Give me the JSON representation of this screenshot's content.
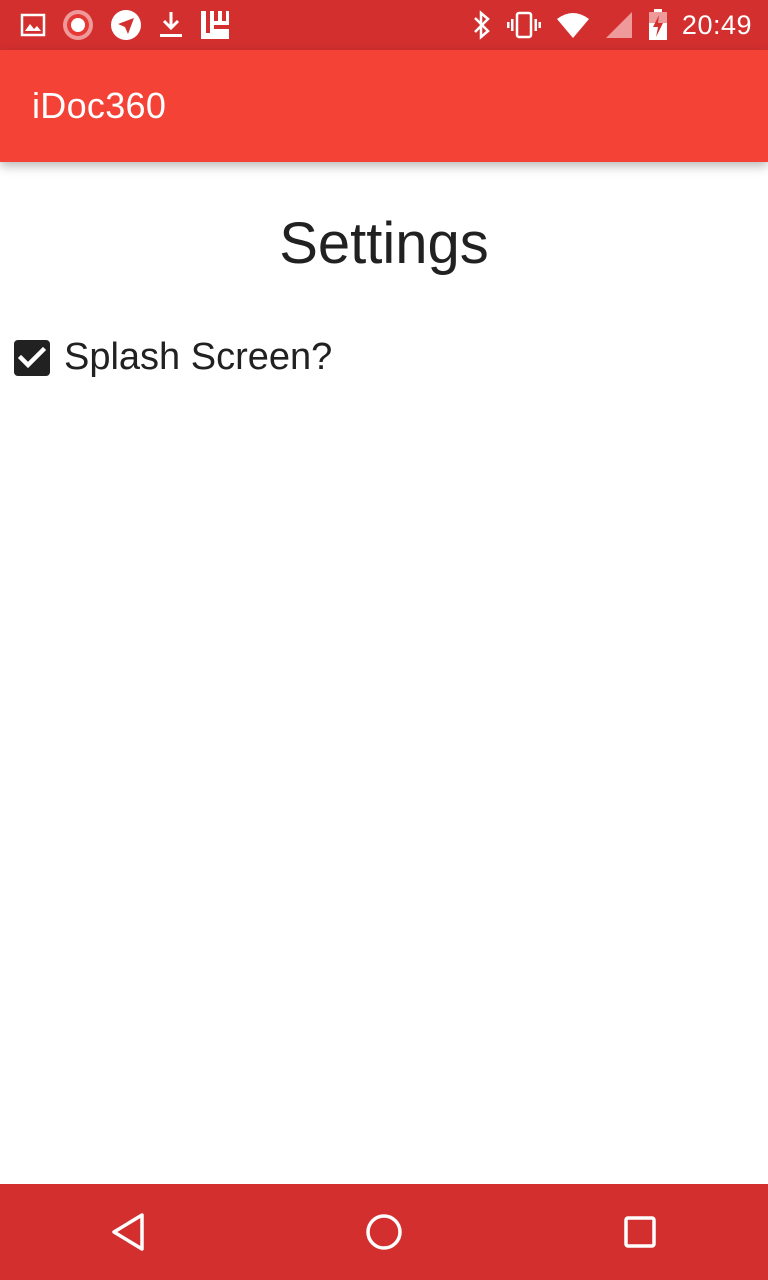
{
  "status_bar": {
    "time": "20:49",
    "left_icons": [
      "image-icon",
      "record-icon",
      "telegram-icon",
      "download-icon",
      "app-logo-icon"
    ],
    "right_icons": [
      "bluetooth-icon",
      "vibrate-icon",
      "wifi-icon",
      "signal-icon",
      "battery-charging-icon"
    ],
    "color": "#d32f2f"
  },
  "app_bar": {
    "title": "iDoc360",
    "color": "#f44336"
  },
  "main": {
    "title": "Settings",
    "settings": [
      {
        "label": "Splash Screen?",
        "checked": true
      }
    ]
  },
  "nav_bar": {
    "buttons": [
      "back-icon",
      "home-icon",
      "recents-icon"
    ],
    "color": "#d32f2f"
  }
}
